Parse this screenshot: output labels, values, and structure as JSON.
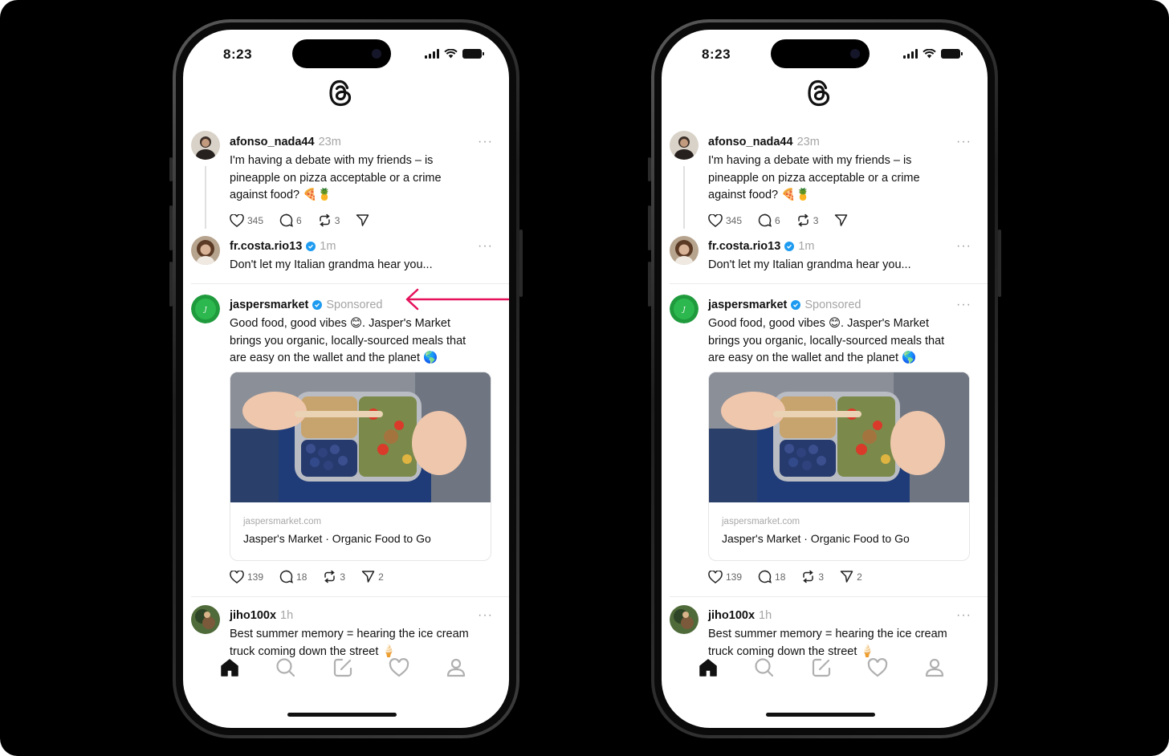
{
  "status_bar": {
    "time": "8:23"
  },
  "feed": {
    "posts": [
      {
        "username": "afonso_nada44",
        "time": "23m",
        "text": "I'm having a debate with my friends – is pineapple on pizza acceptable or a crime against food? 🍕🍍",
        "likes": "345",
        "replies": "6",
        "reposts": "3"
      },
      {
        "username": "fr.costa.rio13",
        "time": "1m",
        "text": "Don't let my Italian grandma hear you..."
      },
      {
        "username": "jaspersmarket",
        "sponsored_label": "Sponsored",
        "text": "Good food, good vibes 😊. Jasper's Market brings you organic, locally-sourced meals that are easy on the wallet and the planet 🌎",
        "link_domain": "jaspersmarket.com",
        "link_title": "Jasper's Market · Organic Food to Go",
        "likes": "139",
        "replies": "18",
        "reposts": "3",
        "shares": "2"
      },
      {
        "username": "jiho100x",
        "time": "1h",
        "text": "Best summer memory = hearing the ice cream truck coming down the street 🍦"
      }
    ]
  },
  "more_label": "···",
  "colors": {
    "annotation_arrow": "#e5125b",
    "verified": "#1d9bf0",
    "background": "#000000"
  },
  "tabbar": {
    "icons": [
      "home-icon",
      "search-icon",
      "compose-icon",
      "heart-icon",
      "profile-icon"
    ]
  }
}
